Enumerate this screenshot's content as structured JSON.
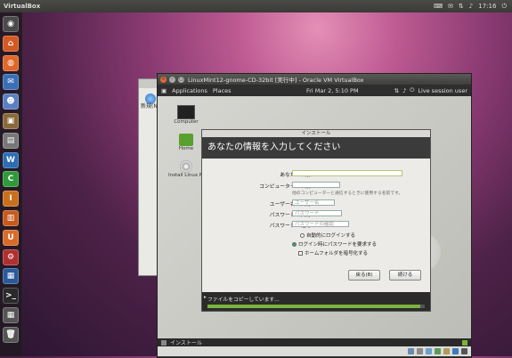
{
  "top_panel": {
    "app_title": "VirtualBox",
    "clock": "17:16"
  },
  "launcher": {
    "items": [
      {
        "name": "dash-home",
        "glyph": "◉",
        "color": "#4a4a4a"
      },
      {
        "name": "home-folder",
        "glyph": "⌂",
        "color": "#d35a22"
      },
      {
        "name": "firefox",
        "glyph": "◍",
        "color": "#e0662a"
      },
      {
        "name": "thunderbird",
        "glyph": "✉",
        "color": "#3a6fb5"
      },
      {
        "name": "empathy",
        "glyph": "☻",
        "color": "#5b7fc2"
      },
      {
        "name": "shotwell",
        "glyph": "▣",
        "color": "#8a6a3a"
      },
      {
        "name": "libreoffice",
        "glyph": "▤",
        "color": "#777"
      },
      {
        "name": "libreoffice-writer",
        "glyph": "W",
        "color": "#2c6db3"
      },
      {
        "name": "libreoffice-calc",
        "glyph": "C",
        "color": "#2f9a3a"
      },
      {
        "name": "libreoffice-impress",
        "glyph": "I",
        "color": "#c9701c"
      },
      {
        "name": "ubuntu-software-center",
        "glyph": "▥",
        "color": "#c65b1e"
      },
      {
        "name": "ubuntu-one",
        "glyph": "U",
        "color": "#d96b2a"
      },
      {
        "name": "system-settings",
        "glyph": "⚙",
        "color": "#b03030"
      },
      {
        "name": "virtualbox",
        "glyph": "▦",
        "color": "#2a5a9a"
      },
      {
        "name": "terminal",
        "glyph": ">_",
        "color": "#2a2a2a"
      },
      {
        "name": "workspace-switcher",
        "glyph": "▦",
        "color": "#555"
      },
      {
        "name": "trash",
        "glyph": "🗑",
        "color": "#555"
      }
    ]
  },
  "bg_dialog": {
    "text": "新規(N)"
  },
  "vbox_window": {
    "title": "LinuxMint12-gnome-CD-32bit [実行中] - Oracle VM VirtualBox"
  },
  "guest_panel": {
    "applications": "Applications",
    "places": "Places",
    "datetime": "Fri Mar  2,  5:10 PM",
    "session": "Live session user"
  },
  "desktop_icons": {
    "computer": "Computer",
    "home": "Home",
    "install": "Install Linux Mint"
  },
  "installer": {
    "window_title": "インストール",
    "heading": "あなたの情報を入力してください",
    "fields": {
      "your_name_label": "あなたの名前:",
      "your_name_value": "",
      "computer_name_label": "コンピューターの名前:",
      "computer_name_value": "",
      "computer_name_hint": "他のコンピューターと通信するときに使用する名前です。",
      "username_label": "ユーザー名の入力:",
      "username_placeholder": "ユーザー名",
      "password_label": "パスワードの入力:",
      "password_placeholder": "パスワード",
      "confirm_label": "パスワードの確認:",
      "confirm_placeholder": "パスワードの確認"
    },
    "options": {
      "auto_login": "自動的にログインする",
      "require_password": "ログイン時にパスワードを要求する",
      "encrypt_home": "ホームフォルダを暗号化する"
    },
    "buttons": {
      "back": "戻る(B)",
      "continue": "続ける"
    },
    "progress": {
      "text": "ファイルをコピーしています...",
      "fraction": 0.98
    }
  },
  "bottom_bar": {
    "task": "インストール"
  },
  "colors": {
    "progress_fill": "#7bb33c",
    "mint_green": "#5aa02c",
    "heading_bg": "#3b3b3b"
  }
}
